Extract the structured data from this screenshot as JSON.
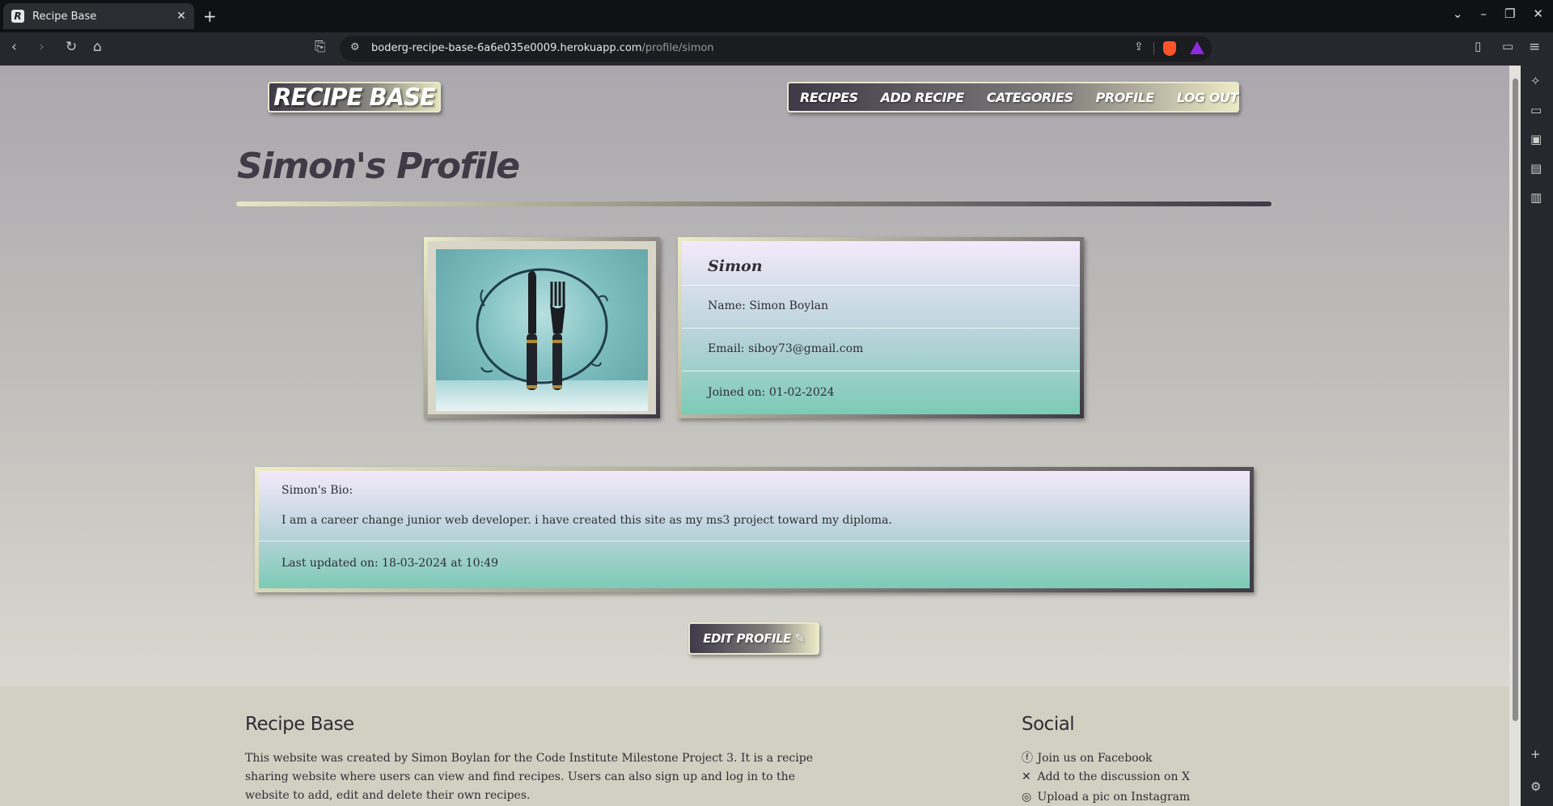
{
  "browser": {
    "tab_title": "Recipe Base",
    "tab_favicon": "R",
    "url_host": "boderg-recipe-base-6a6e035e0009.herokuapp.com",
    "url_path": "/profile/simon"
  },
  "nav": {
    "logo": "RECIPE BASE",
    "items": [
      "RECIPES",
      "ADD RECIPE",
      "CATEGORIES",
      "PROFILE",
      "LOG OUT"
    ]
  },
  "profile": {
    "title": "Simon's Profile",
    "username": "Simon",
    "name": "Name: Simon Boylan",
    "email": "Email: siboy73@gmail.com",
    "joined": "Joined on: 01-02-2024"
  },
  "bio": {
    "heading": "Simon's Bio:",
    "text": "I am a career change junior web developer. i have created this site as my ms3 project toward my diploma.",
    "updated": "Last updated on: 18-03-2024 at 10:49"
  },
  "edit_button": "EDIT PROFILE",
  "footer": {
    "about_title": "Recipe Base",
    "about_text": "This website was created by Simon Boylan for the Code Institute Milestone Project 3. It is a recipe sharing website where users can view and find recipes. Users can also sign up and log in to the website to add, edit and delete their own recipes.",
    "social_title": "Social",
    "links": [
      "Join us on Facebook",
      "Add to the discussion on X",
      "Upload a pic on Instagram"
    ]
  }
}
